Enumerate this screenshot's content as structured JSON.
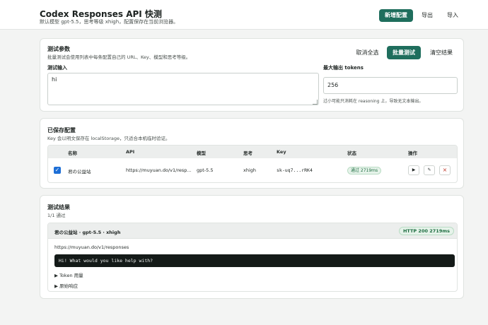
{
  "header": {
    "title": "Codex Responses API 快测",
    "subtitle": "默认模型 gpt-5.5，思考等级 xhigh，配置保存在当前浏览器。",
    "add_label": "新增配置",
    "export_label": "导出",
    "import_label": "导入"
  },
  "params": {
    "title": "测试参数",
    "subtitle": "批量测试会使用列表中每条配置自己的 URL、Key、模型和思考等级。",
    "deselect_label": "取消全选",
    "batch_label": "批量测试",
    "clear_label": "清空结果",
    "input_label": "测试输入",
    "input_value": "hi",
    "max_tokens_label": "最大输出 tokens",
    "max_tokens_value": "256",
    "max_tokens_hint": "过小可能只消耗在 reasoning 上，导致无文本输出。"
  },
  "saved": {
    "title": "已保存配置",
    "subtitle": "Key 会以明文保存在 localStorage，只适合本机临时验证。",
    "columns": [
      "名称",
      "API",
      "模型",
      "思考",
      "Key",
      "状态",
      "操作"
    ],
    "rows": [
      {
        "name": "君の公益站",
        "api": "https://muyuan.do/v1/resp...",
        "model": "gpt-5.5",
        "effort": "xhigh",
        "key": "sk-uq7...rRK4",
        "status": "通过 2719ms",
        "run_icon": "▶",
        "edit_icon": "✎",
        "delete_icon": "×"
      }
    ]
  },
  "results": {
    "title": "测试结果",
    "summary": "1/1 通过",
    "items": [
      {
        "name": "君の公益站 · gpt-5.5 · xhigh",
        "http": "HTTP 200 2719ms",
        "url": "https://muyuan.do/v1/responses",
        "output": "Hi! What would you like help with?",
        "token_usage_label": "▶ Token 用量",
        "raw_label": "▶ 原始响应"
      }
    ]
  },
  "colors": {
    "accent": "#1f6e5d",
    "success_bg": "#e6f3ea",
    "success_text": "#1f6e42",
    "checkbox": "#1e6fd6"
  }
}
